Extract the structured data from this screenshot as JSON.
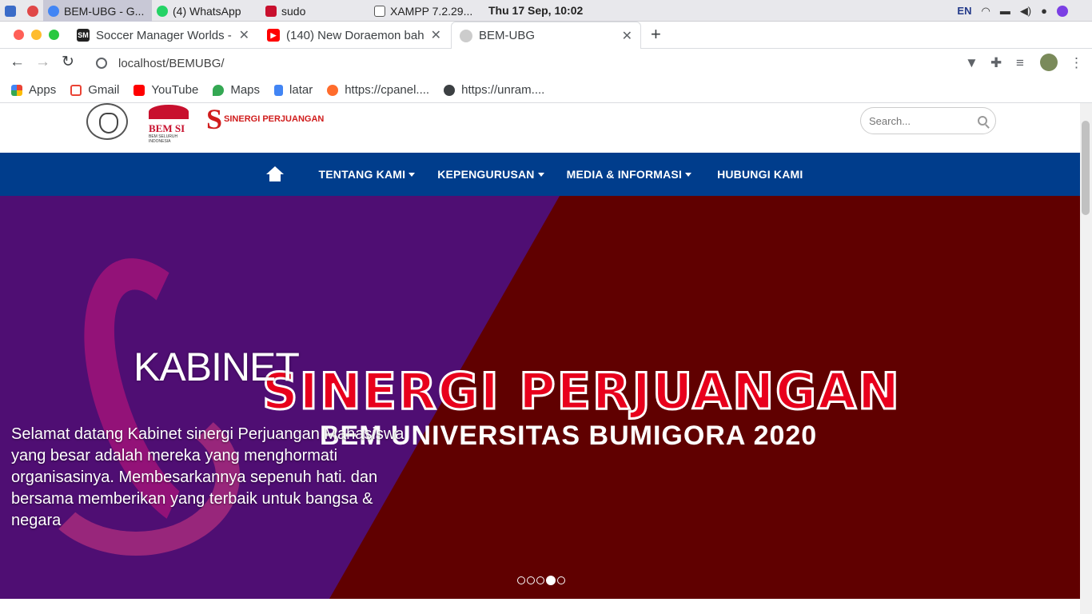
{
  "taskbar": {
    "items": [
      {
        "label": "BEM-UBG - G..."
      },
      {
        "label": "(4) WhatsApp"
      },
      {
        "label": "sudo"
      },
      {
        "label": "XAMPP 7.2.29..."
      }
    ],
    "clock": "Thu 17 Sep, 10:02",
    "lang": "EN"
  },
  "tabs": [
    {
      "title": "Soccer Manager Worlds -",
      "favicon": "SM"
    },
    {
      "title": "(140) New Doraemon bah"
    },
    {
      "title": "BEM-UBG"
    }
  ],
  "address": {
    "url": "localhost/BEMUBG/"
  },
  "bookmarks": [
    {
      "label": "Apps"
    },
    {
      "label": "Gmail"
    },
    {
      "label": "YouTube"
    },
    {
      "label": "Maps"
    },
    {
      "label": "latar"
    },
    {
      "label": "https://cpanel...."
    },
    {
      "label": "https://unram...."
    }
  ],
  "site": {
    "logos": {
      "bemsi_text": "BEM SI",
      "bemsi_sub": "BEM SELURUH INDONESIA",
      "sp_text": "SINERGI PERJUANGAN"
    },
    "search": {
      "placeholder": "Search..."
    },
    "nav": [
      {
        "label": "TENTANG KAMI"
      },
      {
        "label": "KEPENGURUSAN"
      },
      {
        "label": "MEDIA & INFORMASI"
      },
      {
        "label": "HUBUNGI KAMI"
      }
    ],
    "hero": {
      "title": "KABINET",
      "banner_main": "SINERGI PERJUANGAN",
      "banner_sub": "BEM UNIVERSITAS BUMIGORA 2020",
      "lead": "Selamat datang Kabinet sinergi Perjuangan Mahasiswa yang besar adalah mereka yang menghormati organisasinya. Membesarkannya sepenuh hati. dan bersama memberikan yang terbaik untuk bangsa & negara",
      "slides": 5,
      "active_slide": 4
    }
  },
  "colors": {
    "nav": "#003d8c",
    "hero_left": "#4f0e73",
    "hero_right": "#600000"
  }
}
